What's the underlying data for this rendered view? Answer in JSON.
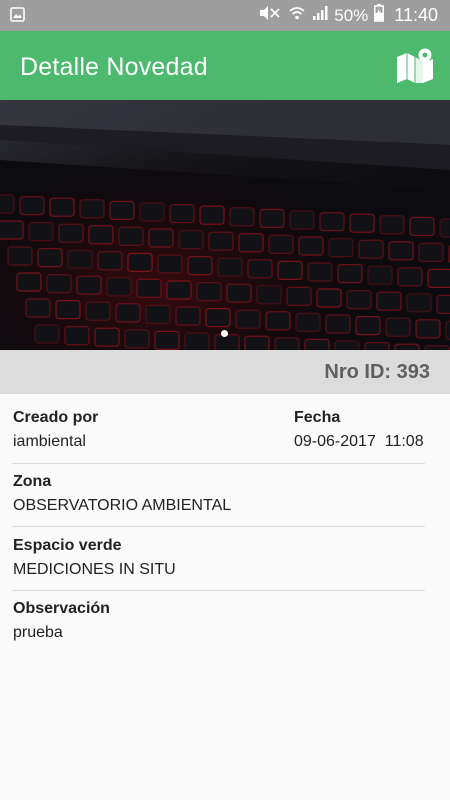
{
  "status_bar": {
    "battery": "50%",
    "time": "11:40",
    "icons": [
      "image-icon",
      "mute-icon",
      "wifi-icon",
      "signal-icon",
      "battery-icon"
    ]
  },
  "app_bar": {
    "title": "Detalle Novedad",
    "action_icon": "map-icon"
  },
  "photo": {
    "pager_total": 1,
    "pager_current": 1
  },
  "id_bar": {
    "text": "Nro ID: 393"
  },
  "details": {
    "creado_por": {
      "label": "Creado por",
      "value": "iambiental"
    },
    "fecha": {
      "label": "Fecha",
      "value": "09-06-2017  11:08"
    },
    "zona": {
      "label": "Zona",
      "value": "OBSERVATORIO AMBIENTAL"
    },
    "espacio_verde": {
      "label": "Espacio verde",
      "value": "MEDICIONES IN SITU"
    },
    "observacion": {
      "label": "Observación",
      "value": "prueba"
    }
  },
  "colors": {
    "app_bar": "#4cb96f",
    "status_bar": "#9e9e9e",
    "id_bar": "#dcdcdc"
  }
}
